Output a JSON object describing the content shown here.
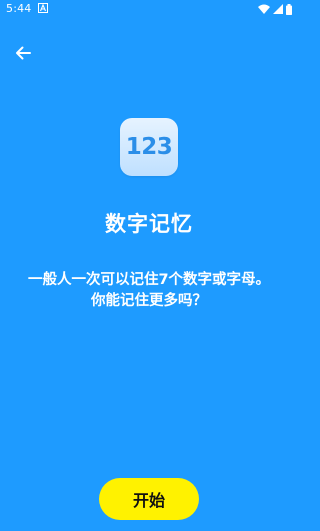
{
  "status_bar": {
    "time": "5:44",
    "notification_icon": "a-letter-icon",
    "wifi_icon": "wifi-icon",
    "signal_icon": "signal-icon",
    "battery_icon": "battery-icon"
  },
  "toolbar": {
    "back_icon": "arrow-left-icon"
  },
  "main": {
    "icon_text": "123",
    "title": "数字记忆",
    "description_line1": "一般人一次可以记住7个数字或字母。",
    "description_line2": "你能记住更多吗？",
    "start_button_label": "开始"
  },
  "colors": {
    "background": "#1E9BFF",
    "button": "#FFF200",
    "icon_text": "#2B8EE8"
  }
}
